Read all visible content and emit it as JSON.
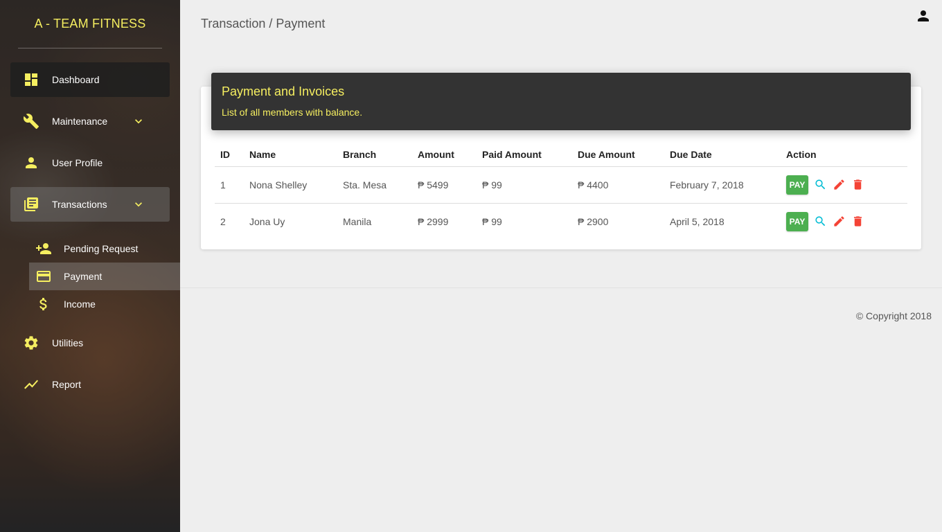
{
  "sidebar": {
    "brand": "A - TEAM FITNESS",
    "items": [
      {
        "label": "Dashboard",
        "icon": "dashboard-icon"
      },
      {
        "label": "Maintenance",
        "icon": "wrench-icon"
      },
      {
        "label": "User Profile",
        "icon": "person-icon"
      },
      {
        "label": "Transactions",
        "icon": "library-books-icon"
      },
      {
        "label": "Utilities",
        "icon": "gear-icon"
      },
      {
        "label": "Report",
        "icon": "trending-line-icon"
      }
    ],
    "transactions_sub": [
      {
        "label": "Pending Request",
        "icon": "person-add-icon"
      },
      {
        "label": "Payment",
        "icon": "credit-card-icon"
      },
      {
        "label": "Income",
        "icon": "dollar-icon"
      }
    ]
  },
  "header": {
    "breadcrumb": "Transaction / Payment"
  },
  "card": {
    "title": "Payment and Invoices",
    "subtitle": "List of all members with balance."
  },
  "table": {
    "columns": [
      "ID",
      "Name",
      "Branch",
      "Amount",
      "Paid Amount",
      "Due Amount",
      "Due Date",
      "Action"
    ],
    "rows": [
      {
        "id": "1",
        "name": "Nona Shelley",
        "branch": "Sta. Mesa",
        "amount": "₱ 5499",
        "paid": "₱ 99",
        "due": "₱ 4400",
        "due_date": "February 7, 2018"
      },
      {
        "id": "2",
        "name": "Jona Uy",
        "branch": "Manila",
        "amount": "₱ 2999",
        "paid": "₱ 99",
        "due": "₱ 2900",
        "due_date": "April 5, 2018"
      }
    ],
    "pay_label": "PAY"
  },
  "footer": {
    "copyright": "© Copyright 2018"
  },
  "colors": {
    "accent": "#f5ee60",
    "pay": "#4caf50",
    "view": "#00bcd4",
    "edit": "#f44336",
    "delete": "#f44336"
  }
}
